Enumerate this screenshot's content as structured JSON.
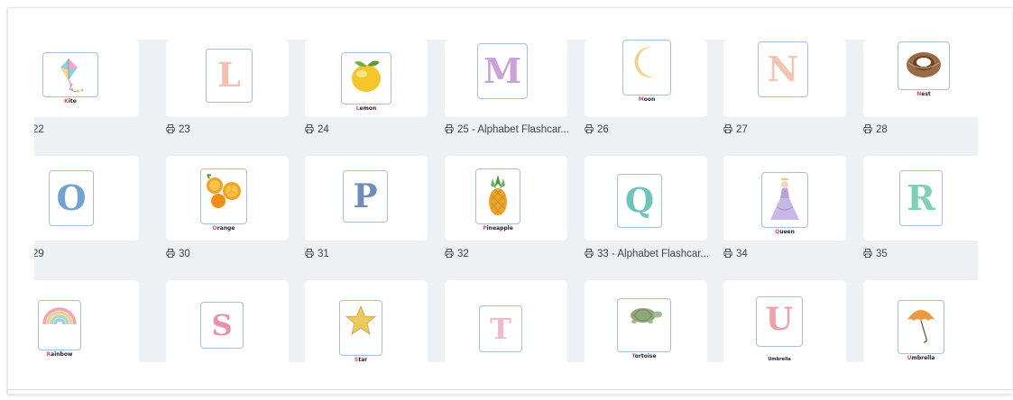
{
  "rows": [
    {
      "cells": [
        {
          "id": "k",
          "word": "Kite",
          "letter": null,
          "icon": "kite-icon",
          "caption": "22"
        },
        {
          "id": "l",
          "word": null,
          "letter": "L",
          "letter_color": "#f2c1b3",
          "caption": "23"
        },
        {
          "id": "lemon",
          "word": "Lemon",
          "letter": null,
          "icon": "lemon-icon",
          "caption": "24"
        },
        {
          "id": "m",
          "word": null,
          "letter": "M",
          "letter_color": "#c9a3d8",
          "caption": "25 - Alphabet Flashcar..."
        },
        {
          "id": "moon",
          "word": "Moon",
          "letter": null,
          "icon": "moon-icon",
          "caption": "26"
        },
        {
          "id": "n",
          "word": null,
          "letter": "N",
          "letter_color": "#f1c6b5",
          "caption": "27"
        },
        {
          "id": "nest",
          "word": "Nest",
          "letter": null,
          "icon": "nest-icon",
          "caption": "28"
        }
      ]
    },
    {
      "cells": [
        {
          "id": "o",
          "word": null,
          "letter": "O",
          "letter_color": "#6ea4d4",
          "caption": "29"
        },
        {
          "id": "orange",
          "word": "Orange",
          "letter": null,
          "icon": "orange-icon",
          "caption": "30"
        },
        {
          "id": "p",
          "word": null,
          "letter": "P",
          "letter_color": "#6f8db7",
          "caption": "31"
        },
        {
          "id": "pineapple",
          "word": "Pineapple",
          "letter": null,
          "icon": "pineapple-icon",
          "caption": "32"
        },
        {
          "id": "q",
          "word": null,
          "letter": "Q",
          "letter_color": "#6cc4bd",
          "caption": "33 - Alphabet Flashcar..."
        },
        {
          "id": "queen",
          "word": "Queen",
          "letter": null,
          "icon": "queen-icon",
          "caption": "34"
        },
        {
          "id": "r",
          "word": null,
          "letter": "R",
          "letter_color": "#7fd1b6",
          "caption": "35"
        }
      ]
    },
    {
      "cells": [
        {
          "id": "rainbow",
          "word": "Rainbow",
          "letter": null,
          "icon": "rainbow-icon",
          "caption": null
        },
        {
          "id": "s",
          "word": null,
          "letter": "S",
          "letter_color": "#ec8fa8",
          "caption": null
        },
        {
          "id": "star",
          "word": "Star",
          "letter": null,
          "icon": "star-icon",
          "caption": null
        },
        {
          "id": "t",
          "word": null,
          "letter": "T",
          "letter_color": "#f2b8cc",
          "caption": null
        },
        {
          "id": "tortoise",
          "word": "Tortoise",
          "letter": null,
          "icon": "tortoise-icon",
          "caption": null
        },
        {
          "id": "u",
          "word": "Umbrella",
          "letter": "U",
          "letter_color": "#f0a0a8",
          "caption": null
        },
        {
          "id": "umbrella",
          "word": "Umbrella",
          "letter": null,
          "icon": "umbrella-icon",
          "caption": null
        }
      ]
    }
  ],
  "print_icon": "printer-icon"
}
